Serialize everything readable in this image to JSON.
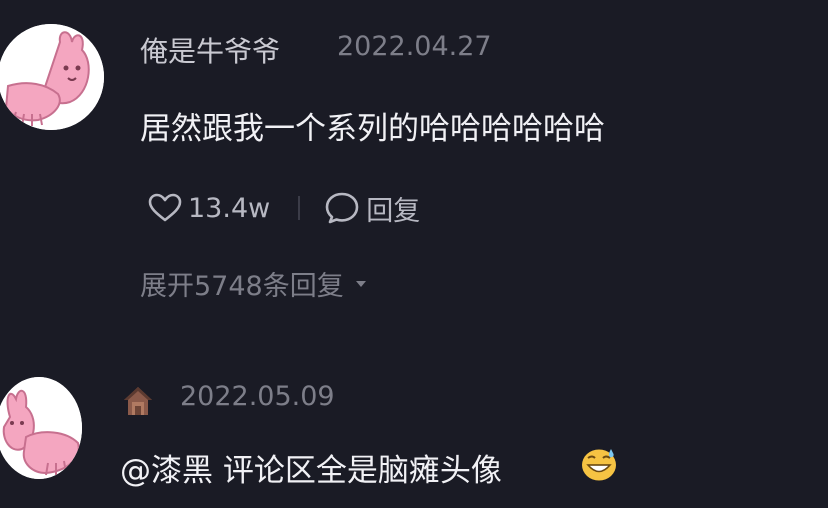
{
  "comments": [
    {
      "username": "俺是牛爷爷",
      "date": "2022.04.27",
      "text": "居然跟我一个系列的哈哈哈哈哈哈",
      "like_count": "13.4w",
      "reply_label": "回复",
      "expand_label": "展开5748条回复",
      "avatar_icon": "pink-rabbit-avatar"
    },
    {
      "username": "",
      "date": "2022.05.09",
      "text": "@漆黑  评论区全是脑瘫头像",
      "badge_icon": "house-badge-icon",
      "emoji_icon": "grinning-sweat-emoji",
      "avatar_icon": "pink-rabbit-avatar"
    }
  ],
  "colors": {
    "background": "#1a1b25",
    "primary_text": "#f1f1f5",
    "secondary_text": "#7d7e89",
    "username_text": "#c9c9d1",
    "avatar_accent": "#f4a6c0"
  }
}
